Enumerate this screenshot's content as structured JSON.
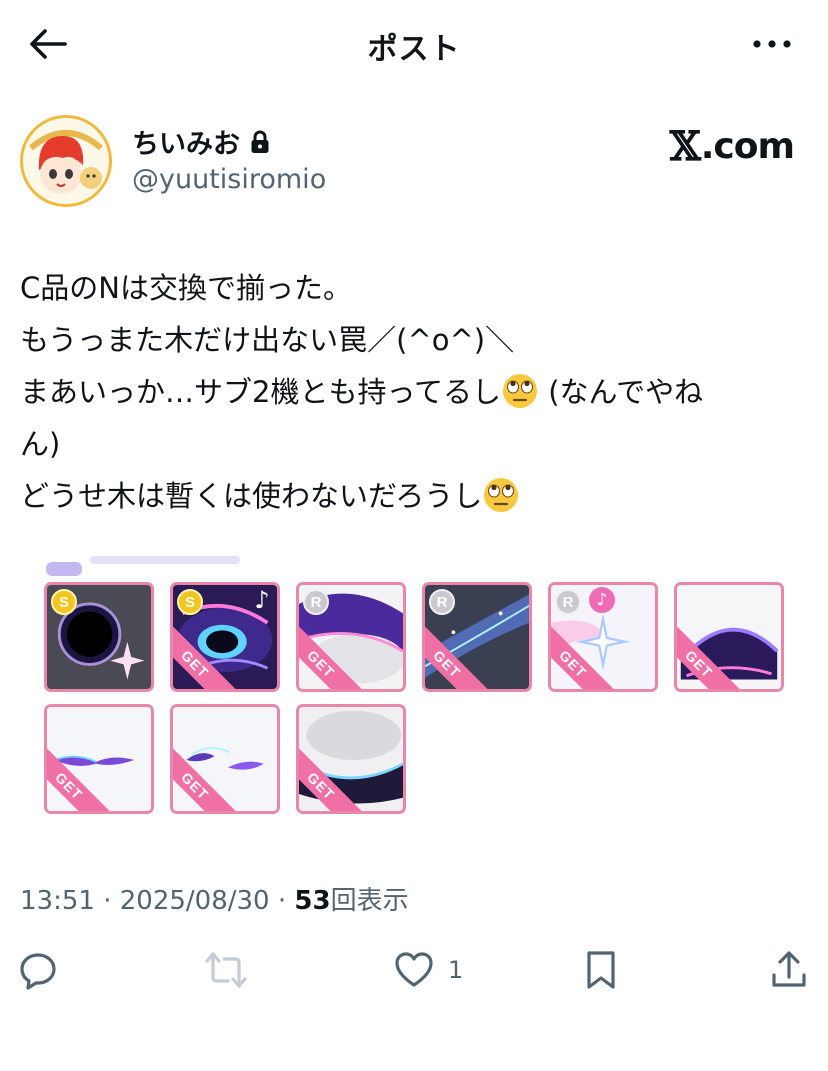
{
  "header": {
    "title": "ポスト",
    "back_icon": "arrow-left-icon",
    "more_icon": "more-horizontal-icon"
  },
  "author": {
    "display_name": "ちいみお",
    "handle": "@yuutisiromio",
    "protected_icon": "lock-icon"
  },
  "watermark": {
    "x_glyph": "𝕏",
    "suffix": ".com"
  },
  "post": {
    "lines": [
      "C品のNは交換で揃った。",
      "もうっまた木だけ出ない罠／(^o^)＼",
      "まあいっか…サブ2機とも持ってるし",
      " (なんでやね",
      "ん)",
      "どうせ木は暫くは使わないだろうし"
    ],
    "emoji": "face-with-rolling-eyes"
  },
  "media": {
    "items": [
      {
        "rank": "S",
        "get": false,
        "music": false
      },
      {
        "rank": "S",
        "get": true,
        "music": true
      },
      {
        "rank": "R",
        "get": true,
        "music": false
      },
      {
        "rank": "R",
        "get": true,
        "music": false
      },
      {
        "rank": "R",
        "get": true,
        "music": true
      },
      {
        "rank": "",
        "get": true,
        "music": false
      },
      {
        "rank": "",
        "get": true,
        "music": false
      },
      {
        "rank": "",
        "get": true,
        "music": false
      },
      {
        "rank": "",
        "get": true,
        "music": false
      }
    ],
    "get_label": "GET"
  },
  "meta": {
    "time": "13:51",
    "sep": "·",
    "date": "2025/08/30",
    "views": "53",
    "views_label": "回表示"
  },
  "actions": {
    "reply_icon": "reply-icon",
    "repost_icon": "repost-icon",
    "like_icon": "heart-icon",
    "like_count": "1",
    "bookmark_icon": "bookmark-icon",
    "share_icon": "share-icon"
  },
  "colors": {
    "text": "#0f1419",
    "muted": "#536471",
    "tile_border": "#e987a8",
    "repost_disabled": "#c4ccd4"
  }
}
